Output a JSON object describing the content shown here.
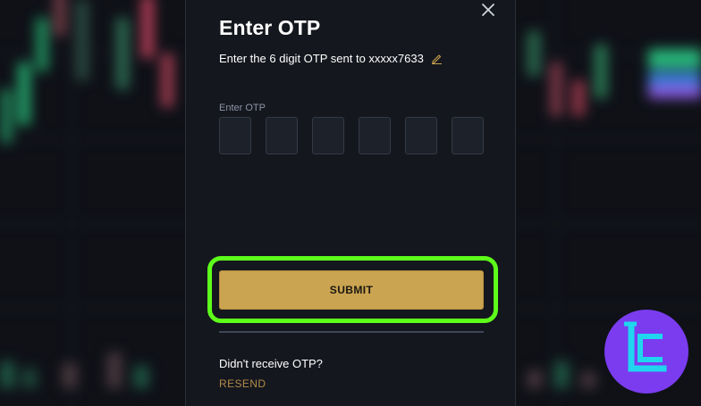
{
  "dialog": {
    "title": "Enter OTP",
    "subtitle": "Enter the 6 digit OTP sent to xxxxx7633",
    "otp_label": "Enter OTP",
    "otp_digits": [
      "",
      "",
      "",
      "",
      "",
      ""
    ],
    "submit_label": "SUBMIT",
    "resend_prompt": "Didn't receive OTP?",
    "resend_label": "RESEND"
  },
  "icons": {
    "close": "close-icon",
    "edit": "pencil-icon",
    "logo": "brand-logo-icon"
  },
  "colors": {
    "accent": "#caa451",
    "highlight": "#5dff1a",
    "resend": "#b28a49",
    "logo_bg": "#7b3cf0",
    "logo_fg": "#1fd6ee"
  }
}
